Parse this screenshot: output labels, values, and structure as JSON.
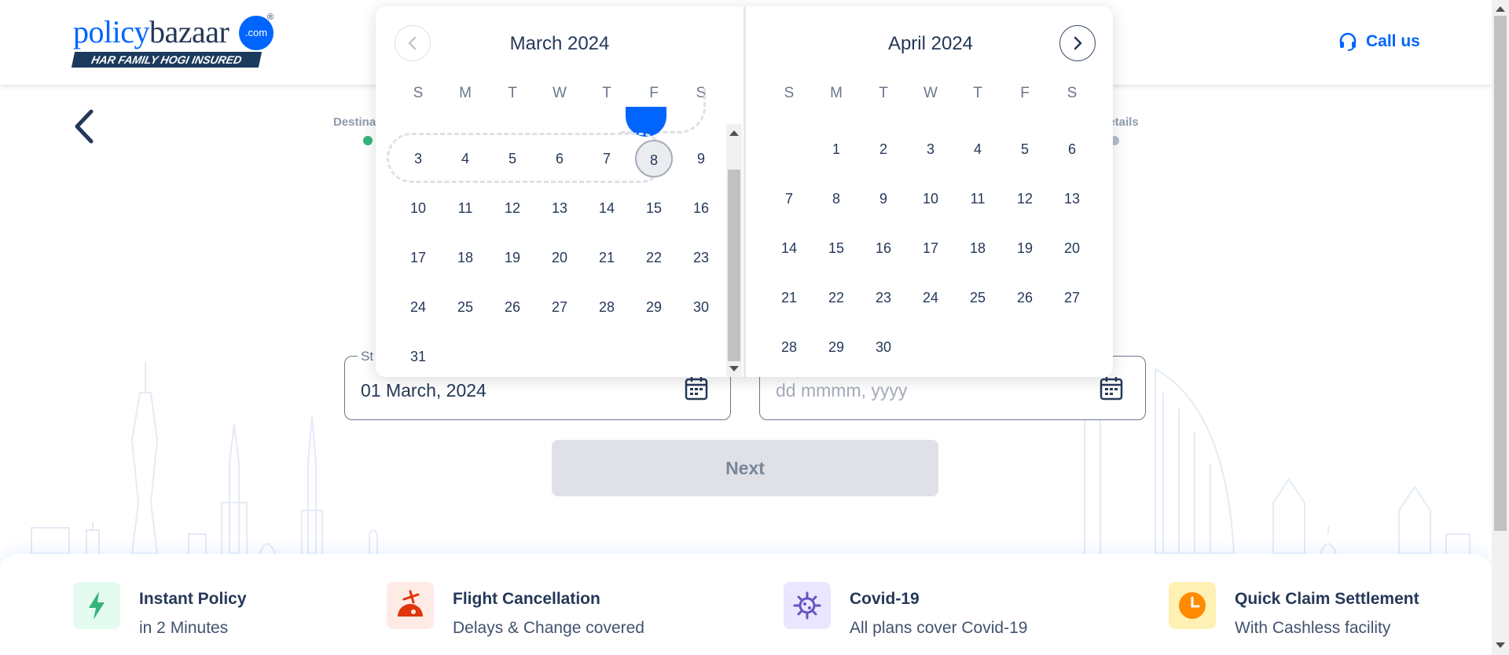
{
  "header": {
    "logo_text_1": "policy",
    "logo_text_2": "bazaar",
    "logo_badge": ".com",
    "logo_reg": "®",
    "logo_tagline": "HAR FAMILY HOGI INSURED",
    "call_label": "Call us"
  },
  "stepper": {
    "step1_label": "Destina",
    "step2_label": "t details"
  },
  "form": {
    "start_label": "St",
    "start_value": "01 March, 2024",
    "end_placeholder": "dd mmmm, yyyy",
    "next_label": "Next"
  },
  "calendar": {
    "left_title": "March 2024",
    "right_title": "April 2024",
    "weekdays": [
      "S",
      "M",
      "T",
      "W",
      "T",
      "F",
      "S"
    ],
    "march_rows": [
      [
        "3",
        "4",
        "5",
        "6",
        "7",
        "8",
        "9"
      ],
      [
        "10",
        "11",
        "12",
        "13",
        "14",
        "15",
        "16"
      ],
      [
        "17",
        "18",
        "19",
        "20",
        "21",
        "22",
        "23"
      ],
      [
        "24",
        "25",
        "26",
        "27",
        "28",
        "29",
        "30"
      ],
      [
        "31"
      ]
    ],
    "march_selected": "8",
    "april_rows": [
      [
        "",
        "1",
        "2",
        "3",
        "4",
        "5",
        "6"
      ],
      [
        "7",
        "8",
        "9",
        "10",
        "11",
        "12",
        "13"
      ],
      [
        "14",
        "15",
        "16",
        "17",
        "18",
        "19",
        "20"
      ],
      [
        "21",
        "22",
        "23",
        "24",
        "25",
        "26",
        "27"
      ],
      [
        "28",
        "29",
        "30"
      ]
    ]
  },
  "features": [
    {
      "title": "Instant Policy",
      "subtitle": "in 2 Minutes",
      "icon": "lightning-icon",
      "bg": "#e3fcef",
      "color": "#36b37e"
    },
    {
      "title": "Flight Cancellation",
      "subtitle": "Delays & Change covered",
      "icon": "flight-cancel-icon",
      "bg": "#ffebe6",
      "color": "#de350b"
    },
    {
      "title": "Covid-19",
      "subtitle": "All plans cover Covid-19",
      "icon": "virus-icon",
      "bg": "#eae6ff",
      "color": "#6554c0"
    },
    {
      "title": "Quick Claim Settlement",
      "subtitle": "With Cashless facility",
      "icon": "clock-icon",
      "bg": "#fff0b3",
      "color": "#ff8b00"
    }
  ],
  "colors": {
    "brand": "#0065ff",
    "text": "#253858",
    "success": "#36b37e"
  }
}
